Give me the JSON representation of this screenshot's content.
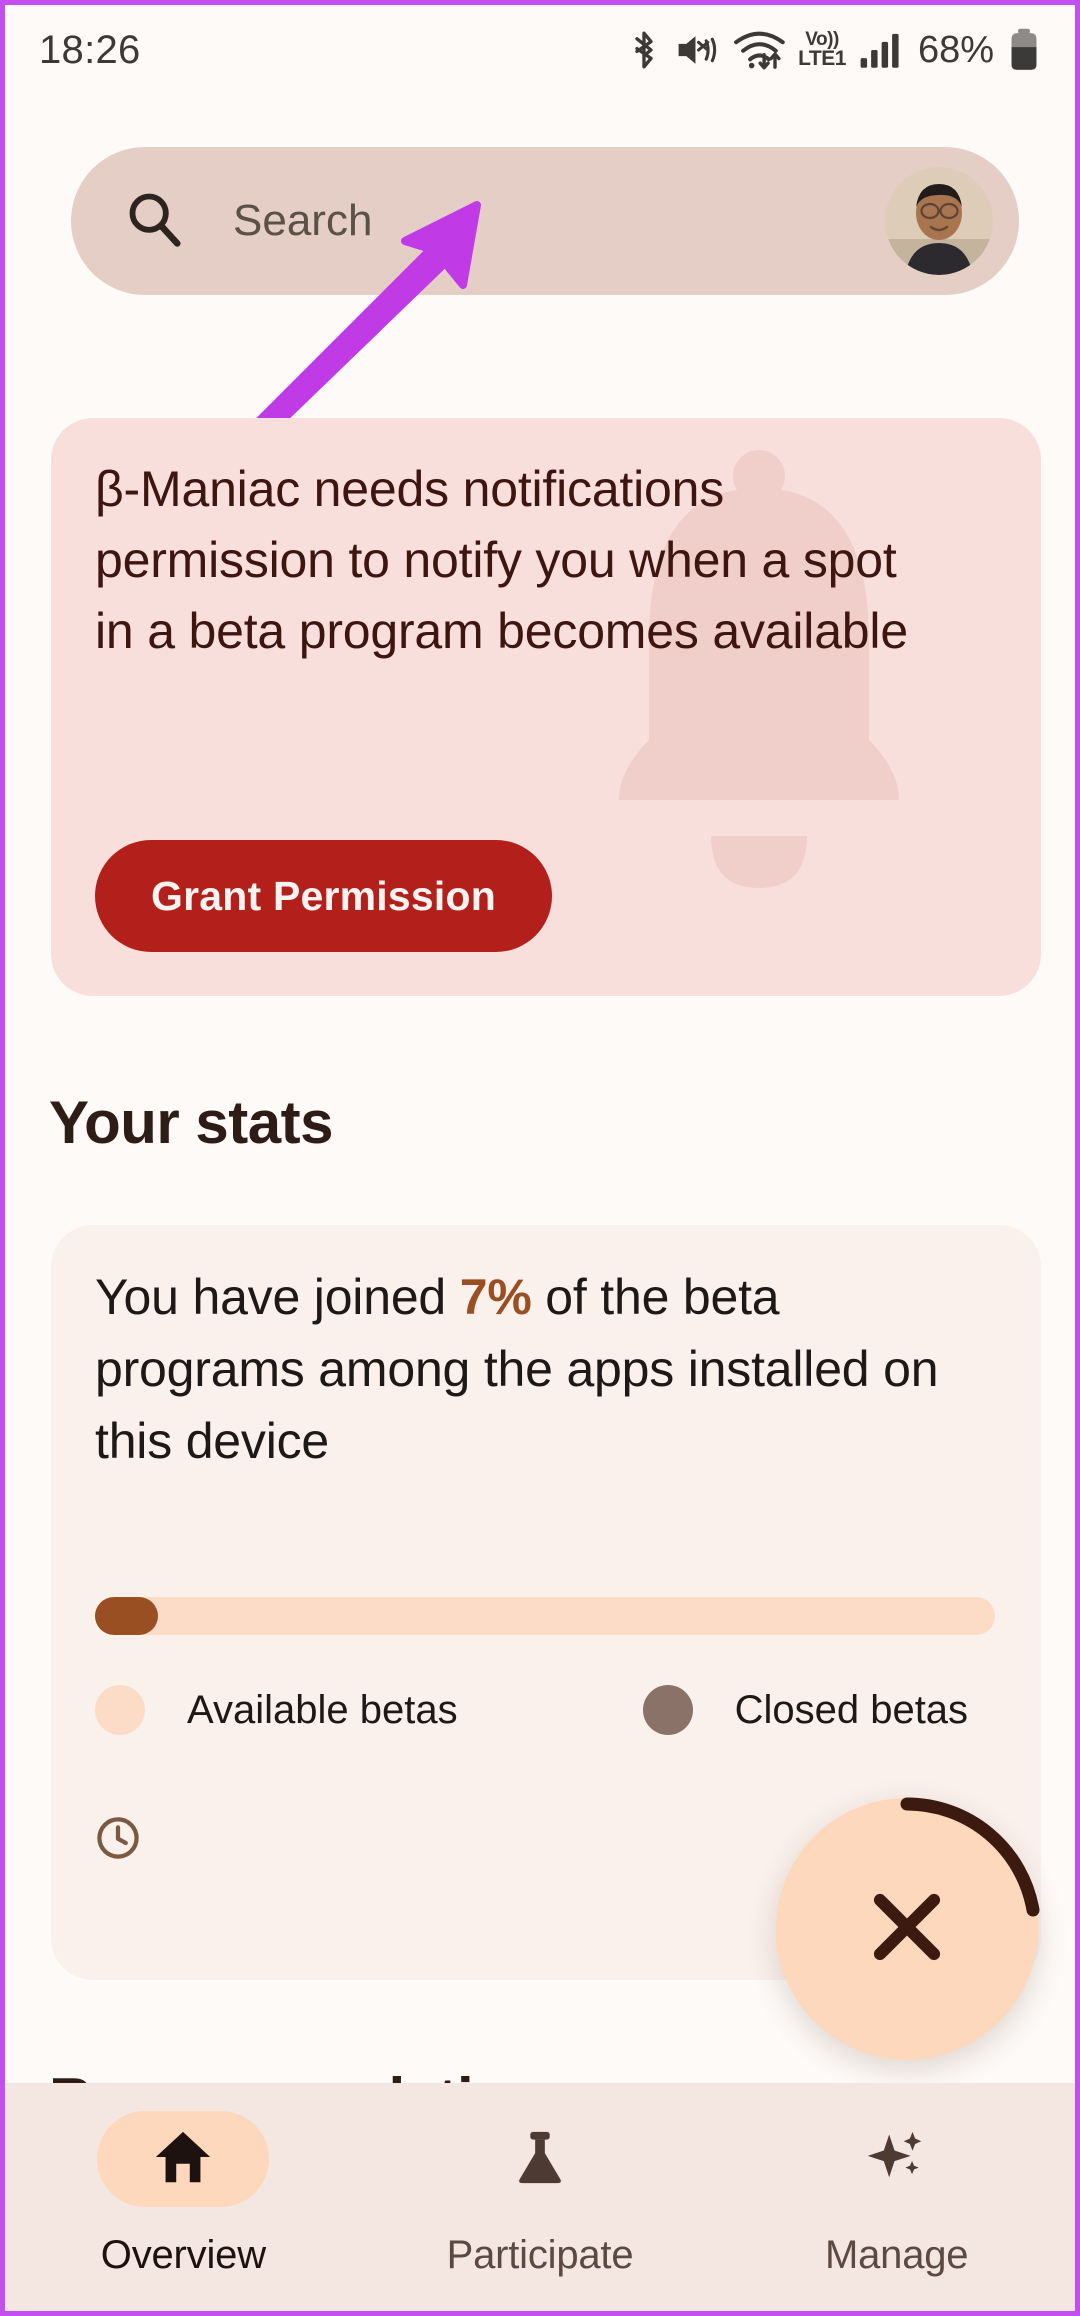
{
  "status_bar": {
    "time": "18:26",
    "battery_percent": "68%",
    "volte_top": "Vo))",
    "volte_bottom": "LTE1",
    "icons": [
      "bluetooth-icon",
      "mute-vibrate-icon",
      "wifi-data-icon",
      "volte-indicator",
      "signal-bars-icon",
      "battery-icon"
    ]
  },
  "search": {
    "placeholder": "Search",
    "icon": "search-icon",
    "avatar": "user-avatar"
  },
  "annotation": {
    "type": "arrow",
    "color": "#c03ae6",
    "points_to": "search-bar"
  },
  "notification_card": {
    "message": "β-Maniac needs notifications permission to notify you when a spot in a beta program becomes available",
    "button_label": "Grant Permission",
    "button_color": "#b3201b",
    "background": "#f9dfdc",
    "watermark_icon": "bell-icon"
  },
  "stats": {
    "section_title": "Your stats",
    "text_before": "You have joined ",
    "percent": "7%",
    "text_after": " of the beta programs among the apps installed on this device",
    "progress_percent": 7,
    "progress_fill_color": "#9a4f22",
    "progress_track_color": "#fcdcc6",
    "legend": [
      {
        "label": "Available betas",
        "color": "#fcdcc6",
        "name": "available-betas"
      },
      {
        "label": "Closed betas",
        "color": "#8b7268",
        "name": "closed-betas"
      }
    ],
    "history_icon": "clock-icon"
  },
  "recommendations": {
    "title": "Recommendations"
  },
  "fab": {
    "icon": "close-icon",
    "background": "#fdd8bd",
    "icon_color": "#3d1a10"
  },
  "bottom_nav": {
    "items": [
      {
        "label": "Overview",
        "icon": "home-icon",
        "active": true
      },
      {
        "label": "Participate",
        "icon": "flask-icon",
        "active": false
      },
      {
        "label": "Manage",
        "icon": "sparkles-icon",
        "active": false
      }
    ]
  }
}
